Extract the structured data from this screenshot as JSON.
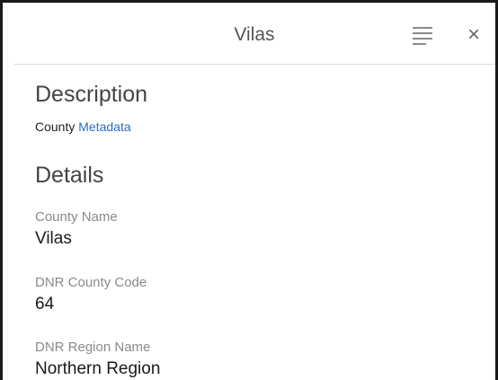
{
  "popup": {
    "title": "Vilas",
    "menu_icon": "menu-lines-icon",
    "close_icon": "close-icon",
    "close_glyph": "×"
  },
  "description": {
    "heading": "Description",
    "text": "County",
    "link_label": "Metadata"
  },
  "details": {
    "heading": "Details",
    "fields": [
      {
        "label": "County Name",
        "value": "Vilas"
      },
      {
        "label": "DNR County Code",
        "value": "64"
      },
      {
        "label": "DNR Region Name",
        "value": "Northern Region"
      }
    ]
  },
  "colors": {
    "link": "#2a6cc4",
    "label": "#8a8a8a",
    "border": "#1a1a1a"
  }
}
